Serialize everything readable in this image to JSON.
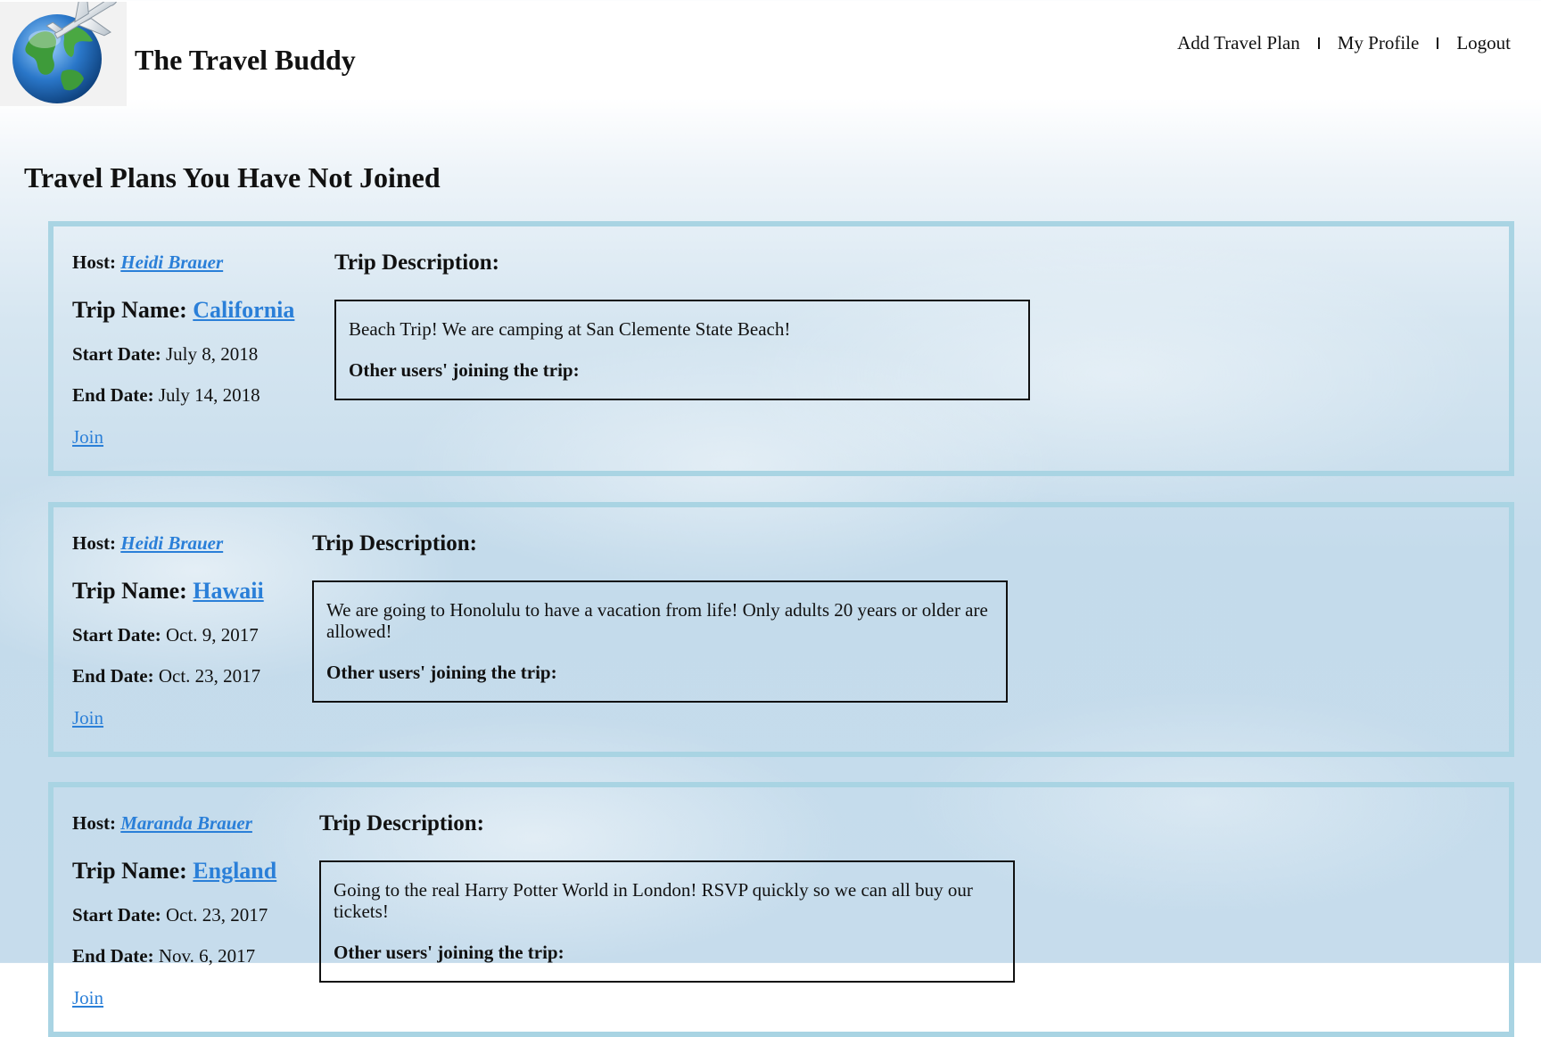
{
  "site": {
    "title": "The Travel Buddy",
    "logo": "globe-airplane-logo"
  },
  "nav": {
    "add_plan": "Add Travel Plan",
    "my_profile": "My Profile",
    "logout": "Logout"
  },
  "page_title": "Travel Plans You Have Not Joined",
  "labels": {
    "host": "Host:",
    "trip_name": "Trip Name:",
    "start_date": "Start Date:",
    "end_date": "End Date:",
    "join": "Join",
    "trip_description": "Trip Description:",
    "other_users": "Other users' joining the trip:"
  },
  "trips": [
    {
      "host": "Heidi Brauer",
      "trip_name": "California",
      "start_date": "July 8, 2018",
      "end_date": "July 14, 2018",
      "description": "Beach Trip! We are camping at San Clemente State Beach!"
    },
    {
      "host": "Heidi Brauer",
      "trip_name": "Hawaii",
      "start_date": "Oct. 9, 2017",
      "end_date": "Oct. 23, 2017",
      "description": "We are going to Honolulu to have a vacation from life! Only adults 20 years or older are allowed!"
    },
    {
      "host": "Maranda Brauer",
      "trip_name": "England",
      "start_date": "Oct. 23, 2017",
      "end_date": "Nov. 6, 2017",
      "description": "Going to the real Harry Potter World in London! RSVP quickly so we can all buy our tickets!"
    }
  ],
  "colors": {
    "card_border": "#a9d4e3",
    "link": "#2a7fd8"
  }
}
